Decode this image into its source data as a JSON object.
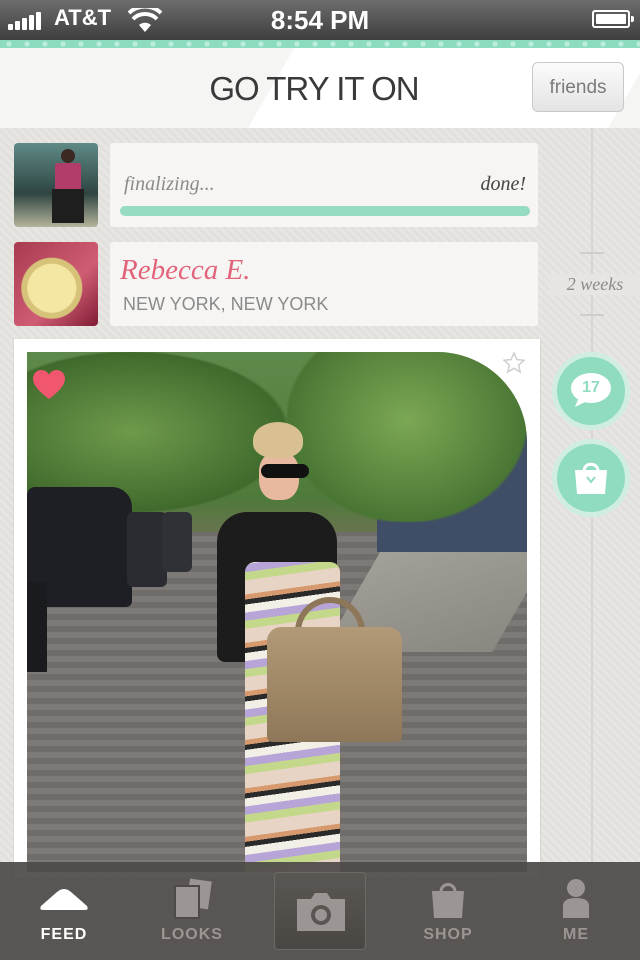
{
  "status_bar": {
    "carrier": "AT&T",
    "time": "8:54 PM"
  },
  "header": {
    "title": "GO TRY IT ON",
    "friends_label": "friends"
  },
  "upload": {
    "status": "finalizing...",
    "done": "done!",
    "progress": 1.0
  },
  "user": {
    "name": "Rebecca E.",
    "location": "NEW YORK, NEW YORK"
  },
  "timeline": {
    "label": "2 weeks"
  },
  "post": {
    "comment_count": "17",
    "liked": true
  },
  "colors": {
    "accent": "#8fdcbf",
    "name": "#e2647a",
    "heart": "#f0566e"
  },
  "tabs": [
    {
      "label": "FEED",
      "icon": "feed-icon",
      "active": true
    },
    {
      "label": "LOOKS",
      "icon": "looks-icon",
      "active": false
    },
    {
      "label": "",
      "icon": "camera-icon",
      "active": false
    },
    {
      "label": "SHOP",
      "icon": "shop-icon",
      "active": false
    },
    {
      "label": "ME",
      "icon": "me-icon",
      "active": false
    }
  ]
}
